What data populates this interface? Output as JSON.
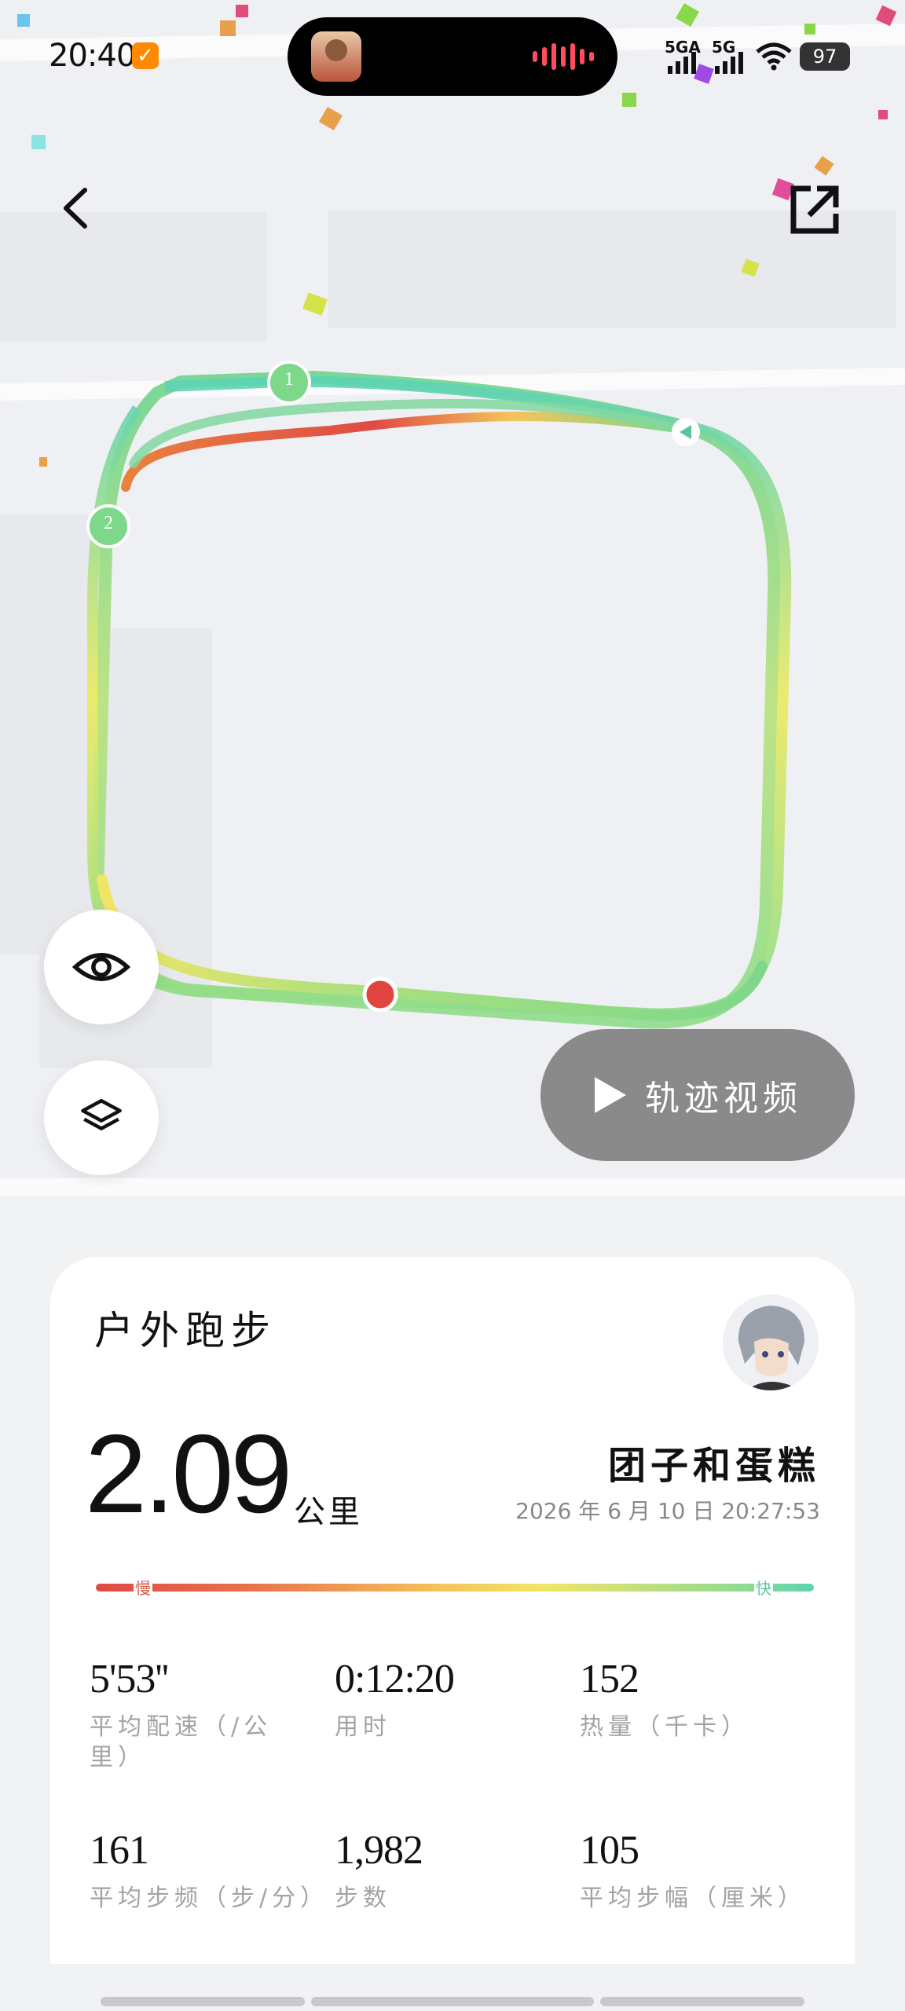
{
  "status_bar": {
    "time": "20:40",
    "signal_1": "5GA",
    "signal_2": "5G",
    "battery": "97"
  },
  "map": {
    "markers": [
      "1",
      "2"
    ],
    "video_button": "轨迹视频"
  },
  "icons": {
    "back": "back-arrow-icon",
    "share": "share-external-icon",
    "visibility": "eye-icon",
    "layers": "layers-icon",
    "play": "play-icon"
  },
  "summary": {
    "sport_type": "户外跑步",
    "distance": "2.09",
    "distance_unit": "公里",
    "username": "团子和蛋糕",
    "datetime": "2026 年 6 月 10 日 20:27:53",
    "pace_slow": "慢",
    "pace_fast": "快"
  },
  "stats": [
    {
      "value": "5'53''",
      "label": "平均配速（/公里）"
    },
    {
      "value": "0:12:20",
      "label": "用时"
    },
    {
      "value": "152",
      "label": "热量（千卡）"
    },
    {
      "value": "161",
      "label": "平均步频（步/分）"
    },
    {
      "value": "1,982",
      "label": "步数"
    },
    {
      "value": "105",
      "label": "平均步幅（厘米）"
    }
  ],
  "colors": {
    "pace_slow": "#df4a45",
    "pace_mid": "#f1e566",
    "pace_fast": "#5cd3b4",
    "route_green": "#7ed88a",
    "start_marker": "#e0463f"
  }
}
